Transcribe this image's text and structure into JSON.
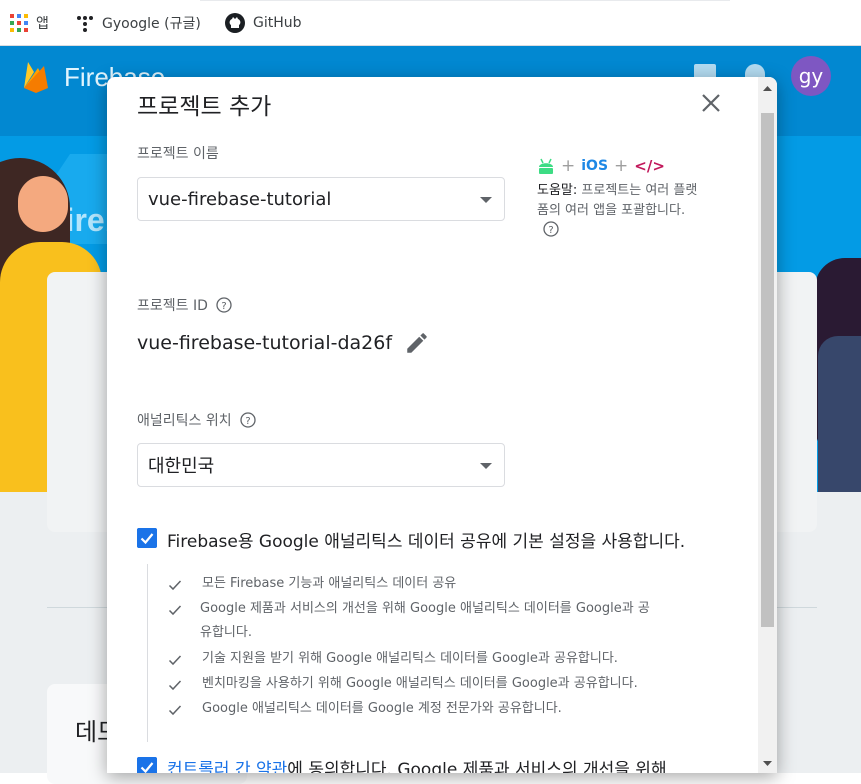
{
  "bookmarks": {
    "items": [
      {
        "label": "앱",
        "icon": "apps-grid-icon"
      },
      {
        "label": "Gyoogle (규글)",
        "icon": "gyoogle-icon"
      },
      {
        "label": "GitHub",
        "icon": "github-icon"
      }
    ]
  },
  "app": {
    "brand": "Firebase",
    "hero_title": "Fireb",
    "avatar_initials": "gy",
    "bottom_card_title": "데모"
  },
  "dialog": {
    "title": "프로젝트 추가",
    "project_name_label": "프로젝트 이름",
    "project_name_value": "vue-firebase-tutorial",
    "platforms": {
      "ios": "iOS",
      "code": "</>"
    },
    "tip_bold": "도움말:",
    "tip_text": " 프로젝트는 여러 플랫폼의 여러 앱을 포괄합니다.",
    "project_id_label": "프로젝트 ID",
    "project_id_value": "vue-firebase-tutorial-da26f",
    "analytics_location_label": "애널리틱스 위치",
    "analytics_location_value": "대한민국",
    "share_checkbox_label": "Firebase용 Google 애널리틱스 데이터 공유에 기본 설정을 사용합니다.",
    "share_items": [
      "모든 Firebase 기능과 애널리틱스 데이터 공유",
      "Google 제품과 서비스의 개선을 위해 Google 애널리틱스 데이터를 Google과 공",
      "유합니다.",
      "기술 지원을 받기 위해 Google 애널리틱스 데이터를 Google과 공유합니다.",
      "벤치마킹을 사용하기 위해 Google 애널리틱스 데이터를 Google과 공유합니다.",
      "Google 애널리틱스 데이터를 Google 계정 전문가와 공유합니다."
    ],
    "terms_link": "컨트롤러 간 약관",
    "terms_text": "에 동의합니다. Google 제품과 서비스의 개선을 위해"
  },
  "colors": {
    "accent": "#1a73e8",
    "hero_bg": "#039be5",
    "firebase_orange": "#ffa000"
  }
}
